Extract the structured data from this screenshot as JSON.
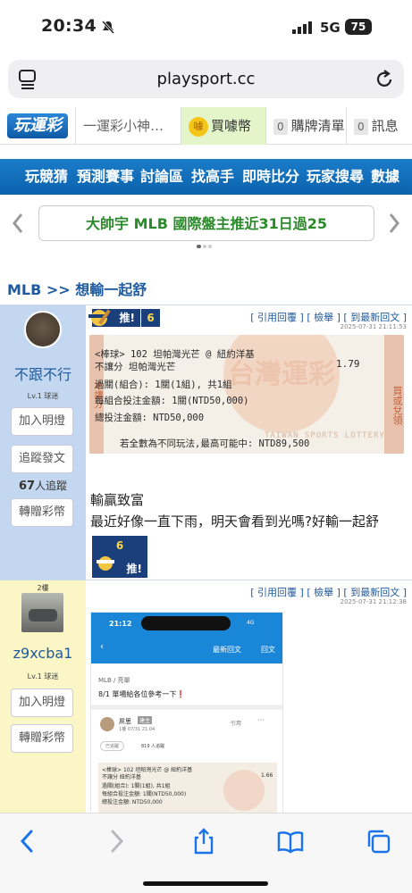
{
  "status": {
    "time": "20:34",
    "network": "5G",
    "battery": "75"
  },
  "browser": {
    "url": "playsport.cc"
  },
  "topnav": {
    "logo": "玩運彩",
    "search_text": "一運彩小神…",
    "buy": "買噱幣",
    "badge_coin": "噱",
    "list_count": "0",
    "list": "購牌清單",
    "msg_count": "0",
    "msg": "訊息"
  },
  "mainnav": [
    "玩競猜",
    "預測賽事",
    "討論區",
    "找高手",
    "即時比分",
    "玩家搜尋",
    "數據"
  ],
  "banner": "大帥宇 MLB 國際盤主推近31日過25",
  "breadcrumb": "MLB >> 想輸一起舒",
  "post1": {
    "username": "不跟不行",
    "level": "Lv.1 球迷",
    "follow_btn": "加入明燈",
    "track_btn": "追蹤發文",
    "followers": "67",
    "followers_suffix": "人追蹤",
    "gift_btn": "轉贈彩幣",
    "push_label": "推!",
    "push_count": "6",
    "actions": "[ 引用回覆 ] [ 檢舉 ] [ 到最新回文 ]",
    "timestamp": "2025-07-31 21:11:53",
    "ticket": {
      "line1": "<棒球> 102    坦帕灣光芒 @ 紐約洋基",
      "line2": "不讓分        坦帕灣光芒",
      "odds": "1.79",
      "line3": "過關(組合): 1關(1組), 共1組",
      "line4": "每組合投注金額: 1關(NTD50,000)",
      "line5": "總投注金額: NTD50,000",
      "line6": "若全數為不同玩法,最高可能中: NTD89,500",
      "brand": "TAIWAN SPORTS LOTTERY",
      "stamp": "台灣運彩",
      "side_left": "不讓分",
      "side_right": "買或兌領"
    },
    "text1": "輸贏致富",
    "text2": "最近好像一直下雨，明天會看到光嗎?好輸一起舒",
    "push2_count": "6",
    "push2_label": "推!"
  },
  "post2": {
    "floor": "2樓",
    "username": "z9xcba1",
    "level": "Lv.1 球迷",
    "follow_btn": "加入明燈",
    "gift_btn": "轉贈彩幣",
    "actions": "[ 引用回覆 ] [ 檢舉 ] [ 到最新回文 ]",
    "timestamp": "2025-07-31 21:12:38",
    "shot": {
      "time": "21:12",
      "net": "4G",
      "header_left": "最新回文",
      "header_right": "回文",
      "crumb": "MLB / 亮單",
      "title": "8/1 單場給各位參考一下❗",
      "user": "屌思",
      "badge": "達主",
      "floor_time": "1樓 07/31 21:04",
      "quote": "引用",
      "verified": "已追蹤",
      "follows": "819 人追蹤",
      "t1": "<棒球> 102    坦帕灣光芒 @ 紐約洋基",
      "t2": "不讓分        紐約洋基",
      "t_odds": "1.66",
      "t3": "過關(組合): 1關(1組), 共1組",
      "t4": "每組合投注金額: 1關(NTD50,000)",
      "t5": "總投注金額: NTD50,000"
    }
  }
}
